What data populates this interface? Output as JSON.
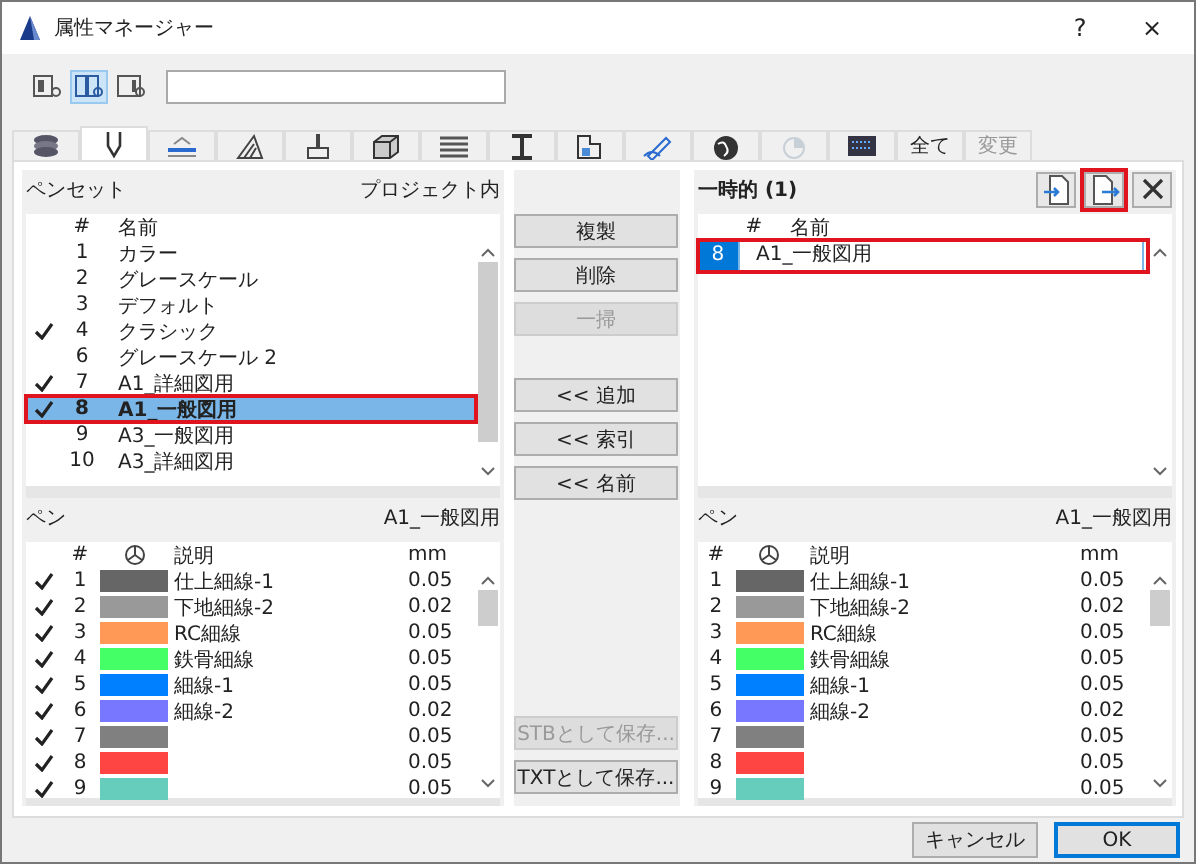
{
  "window": {
    "title": "属性マネージャー",
    "help": "?",
    "close": "×"
  },
  "view_buttons": [
    {
      "selected": false
    },
    {
      "selected": true
    },
    {
      "selected": false
    }
  ],
  "tabs": [
    {
      "kind": "icon",
      "selected": false,
      "disabled": false
    },
    {
      "kind": "icon",
      "selected": true,
      "disabled": false
    },
    {
      "kind": "icon",
      "selected": false,
      "disabled": false
    },
    {
      "kind": "icon",
      "selected": false,
      "disabled": false
    },
    {
      "kind": "icon",
      "selected": false,
      "disabled": false
    },
    {
      "kind": "icon",
      "selected": false,
      "disabled": false
    },
    {
      "kind": "icon",
      "selected": false,
      "disabled": false
    },
    {
      "kind": "icon",
      "selected": false,
      "disabled": false
    },
    {
      "kind": "icon",
      "selected": false,
      "disabled": false
    },
    {
      "kind": "icon",
      "selected": false,
      "disabled": false
    },
    {
      "kind": "icon",
      "selected": false,
      "disabled": false
    },
    {
      "kind": "icon",
      "selected": false,
      "disabled": true
    },
    {
      "kind": "icon",
      "selected": false,
      "disabled": false
    },
    {
      "kind": "text",
      "label": "全て",
      "selected": false,
      "disabled": false
    },
    {
      "kind": "text",
      "label": "変更",
      "selected": false,
      "disabled": true
    }
  ],
  "left": {
    "title": "ペンセット",
    "scope": "プロジェクト内",
    "columns": [
      "#",
      "名前"
    ],
    "rows": [
      {
        "number": "1",
        "name": "カラー",
        "checked": false,
        "selected": false,
        "highlighted": false
      },
      {
        "number": "2",
        "name": "グレースケール",
        "checked": false,
        "selected": false,
        "highlighted": false
      },
      {
        "number": "3",
        "name": "デフォルト",
        "checked": false,
        "selected": false,
        "highlighted": false
      },
      {
        "number": "4",
        "name": "クラシック",
        "checked": true,
        "selected": false,
        "highlighted": false
      },
      {
        "number": "6",
        "name": "グレースケール 2",
        "checked": false,
        "selected": false,
        "highlighted": false
      },
      {
        "number": "7",
        "name": "A1_詳細図用",
        "checked": true,
        "selected": false,
        "highlighted": false
      },
      {
        "number": "8",
        "name": "A1_一般図用",
        "checked": true,
        "selected": true,
        "highlighted": true
      },
      {
        "number": "9",
        "name": "A3_一般図用",
        "checked": false,
        "selected": false,
        "highlighted": false
      },
      {
        "number": "10",
        "name": "A3_詳細図用",
        "checked": false,
        "selected": false,
        "highlighted": false
      }
    ],
    "pens_title": "ペン",
    "pens_set": "A1_一般図用",
    "pen_columns": [
      "#",
      "説明",
      "mm"
    ],
    "pens": [
      {
        "number": "1",
        "color": "#666666",
        "description": "仕上細線-1",
        "mm": "0.05",
        "checked": true
      },
      {
        "number": "2",
        "color": "#999999",
        "description": "下地細線-2",
        "mm": "0.02",
        "checked": true
      },
      {
        "number": "3",
        "color": "#ff9955",
        "description": "RC細線",
        "mm": "0.05",
        "checked": true
      },
      {
        "number": "4",
        "color": "#44ff66",
        "description": "鉄骨細線",
        "mm": "0.05",
        "checked": true
      },
      {
        "number": "5",
        "color": "#0080ff",
        "description": "細線-1",
        "mm": "0.05",
        "checked": true
      },
      {
        "number": "6",
        "color": "#7777ff",
        "description": "細線-2",
        "mm": "0.02",
        "checked": true
      },
      {
        "number": "7",
        "color": "#808080",
        "mm": "0.05",
        "checked": true
      },
      {
        "number": "8",
        "color": "#ff4444",
        "mm": "0.05",
        "checked": true
      },
      {
        "number": "9",
        "color": "#66ccbb",
        "mm": "0.05",
        "checked": true
      }
    ]
  },
  "middle": {
    "edit": [
      {
        "label": "複製",
        "disabled": false
      },
      {
        "label": "削除",
        "disabled": false
      },
      {
        "label": "一掃",
        "disabled": true
      }
    ],
    "transfer": [
      {
        "label": "<< 追加",
        "disabled": false
      },
      {
        "label": "<< 索引",
        "disabled": false
      },
      {
        "label": "<< 名前",
        "disabled": false
      }
    ],
    "save": [
      {
        "label": "STBとして保存...",
        "disabled": true
      },
      {
        "label": "TXTとして保存...",
        "disabled": false
      }
    ]
  },
  "right": {
    "title": "一時的 (1)",
    "header_buttons": [
      {
        "kind": "import",
        "highlighted": false
      },
      {
        "kind": "export",
        "highlighted": true
      },
      {
        "kind": "delete",
        "highlighted": false
      }
    ],
    "columns": [
      "#",
      "名前"
    ],
    "rows": [
      {
        "number": "8",
        "name": "A1_一般図用",
        "selected": true,
        "editing": true,
        "highlighted": true
      }
    ],
    "pens_title": "ペン",
    "pens_set": "A1_一般図用",
    "pen_columns": [
      "#",
      "説明",
      "mm"
    ],
    "pens": [
      {
        "number": "1",
        "color": "#666666",
        "description": "仕上細線-1",
        "mm": "0.05"
      },
      {
        "number": "2",
        "color": "#999999",
        "description": "下地細線-2",
        "mm": "0.02"
      },
      {
        "number": "3",
        "color": "#ff9955",
        "description": "RC細線",
        "mm": "0.05"
      },
      {
        "number": "4",
        "color": "#44ff66",
        "description": "鉄骨細線",
        "mm": "0.05"
      },
      {
        "number": "5",
        "color": "#0080ff",
        "description": "細線-1",
        "mm": "0.05"
      },
      {
        "number": "6",
        "color": "#7777ff",
        "description": "細線-2",
        "mm": "0.02"
      },
      {
        "number": "7",
        "color": "#808080",
        "mm": "0.05"
      },
      {
        "number": "8",
        "color": "#ff4444",
        "mm": "0.05"
      },
      {
        "number": "9",
        "color": "#66ccbb",
        "mm": "0.05"
      }
    ]
  },
  "footer": [
    {
      "label": "キャンセル",
      "kind": "cancel"
    },
    {
      "label": "OK",
      "kind": "default"
    }
  ]
}
